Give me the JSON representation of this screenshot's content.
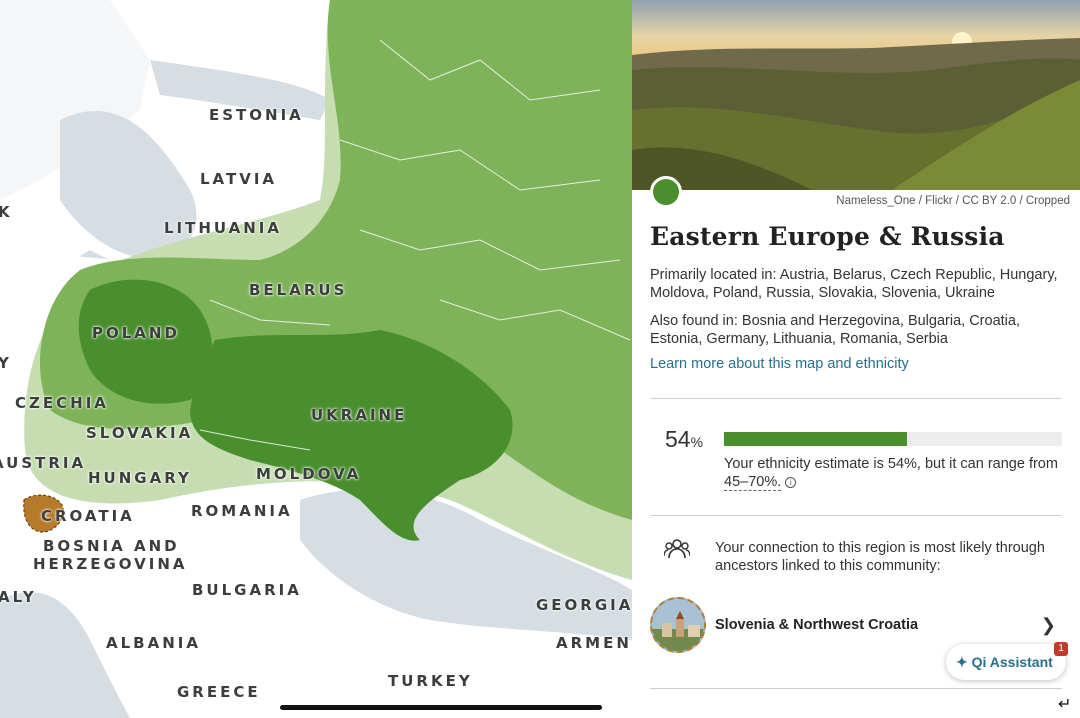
{
  "map": {
    "labels": [
      {
        "id": "estonia",
        "text": "ESTONIA"
      },
      {
        "id": "latvia",
        "text": "LATVIA"
      },
      {
        "id": "lithuania",
        "text": "LITHUANIA"
      },
      {
        "id": "belarus",
        "text": "BELARUS"
      },
      {
        "id": "poland",
        "text": "POLAND"
      },
      {
        "id": "czechia",
        "text": "CZECHIA"
      },
      {
        "id": "slovakia",
        "text": "SLOVAKIA"
      },
      {
        "id": "ukraine",
        "text": "UKRAINE"
      },
      {
        "id": "austria",
        "text": "AUSTRIA"
      },
      {
        "id": "hungary",
        "text": "HUNGARY"
      },
      {
        "id": "moldova",
        "text": "MOLDOVA"
      },
      {
        "id": "croatia",
        "text": "CROATIA"
      },
      {
        "id": "romania",
        "text": "ROMANIA"
      },
      {
        "id": "bosnia1",
        "text": "BOSNIA AND"
      },
      {
        "id": "bosnia2",
        "text": "HERZEGOVINA"
      },
      {
        "id": "bulgaria",
        "text": "BULGARIA"
      },
      {
        "id": "georgia",
        "text": "GEORGIA"
      },
      {
        "id": "italy",
        "text": "ALY"
      },
      {
        "id": "albania",
        "text": "ALBANIA"
      },
      {
        "id": "armenia",
        "text": "ARMENI"
      },
      {
        "id": "greece",
        "text": "GREECE"
      },
      {
        "id": "turkey",
        "text": "TURKEY"
      },
      {
        "id": "edge_k",
        "text": "K"
      },
      {
        "id": "edge_y",
        "text": "Y"
      }
    ],
    "colors": {
      "core": "#4a8f2e",
      "mid": "#7fb35a",
      "outer": "#c6ddb1",
      "community": "#b57a2a",
      "sea": "#d6dde3",
      "land": "#ffffff"
    }
  },
  "panel": {
    "photo_credit": "Nameless_One / Flickr / CC BY 2.0 / Cropped",
    "region_title": "Eastern Europe & Russia",
    "primarily": "Primarily located in: Austria, Belarus, Czech Republic, Hungary, Moldova, Poland, Russia, Slovakia, Slovenia, Ukraine",
    "also": "Also found in: Bosnia and Herzegovina, Bulgaria, Croatia, Estonia, Germany, Lithuania, Romania, Serbia",
    "learn_more": "Learn more about this map and ethnicity",
    "percent_value": "54",
    "percent_sign": "%",
    "estimate_fraction": 0.54,
    "estimate_prefix": "Your ethnicity estimate is 54%, but it can range from",
    "estimate_range": "45–70%.",
    "connection_text": "Your connection to this region is most likely through ancestors linked to this community:",
    "community_name": "Slovenia & Northwest Croatia"
  },
  "assistant": {
    "label": "Qi Assistant",
    "badge": "1"
  }
}
